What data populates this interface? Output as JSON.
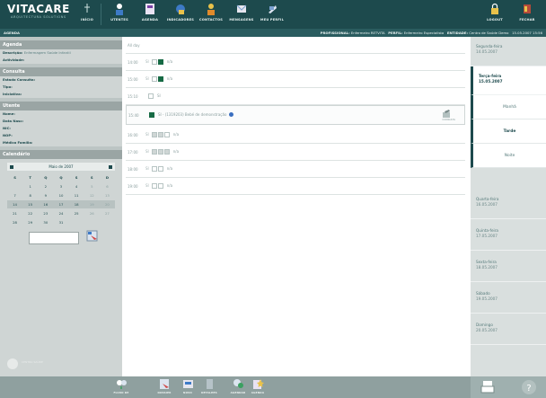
{
  "app": {
    "name": "VITACARE",
    "tagline": "ARQUITECTURA SOLUTIONS"
  },
  "topnav": [
    {
      "id": "inicio",
      "label": "INÍCIO",
      "icon": "home-icon"
    },
    {
      "id": "utentes",
      "label": "UTENTES",
      "icon": "user-icon"
    },
    {
      "id": "agenda",
      "label": "AGENDA",
      "icon": "agenda-icon"
    },
    {
      "id": "indicadores",
      "label": "INDICADORES",
      "icon": "indicators-icon"
    },
    {
      "id": "contactos",
      "label": "CONTACTOS",
      "icon": "contacts-icon"
    },
    {
      "id": "mensagens",
      "label": "MENSAGENS",
      "icon": "messages-icon"
    },
    {
      "id": "meu-perfil",
      "label": "MEU PERFIL",
      "icon": "profile-icon"
    }
  ],
  "topright": {
    "logout": "LOGOUT",
    "fechar": "FECHAR"
  },
  "infobar": {
    "section": "AGENDA",
    "profissional_label": "PROFISSIONAL:",
    "profissional_value": "Enfermeiro RETVITA",
    "perfil_label": "PERFIL:",
    "perfil_value": "Enfermeiro Especialista",
    "entidade_label": "ENTIDADE:",
    "entidade_value": "Centro de Saúde Demo",
    "datetime": "15.05.2007 15:56"
  },
  "sidebar": {
    "agenda": {
      "title": "Agenda",
      "descricao_label": "Descrição:",
      "descricao_value": "Enfermagem Saúde Infantil",
      "actividade_label": "Actividade:"
    },
    "consulta": {
      "title": "Consulta",
      "estado_label": "Estado Consulta:",
      "tipo_label": "Tipo:",
      "iniciativa_label": "Iniciativa:"
    },
    "utente": {
      "title": "Utente",
      "nome_label": "Nome:",
      "data_nasc_label": "Data Nasc:",
      "nic_label": "NIC:",
      "nop_label": "NOP:",
      "medico_label": "Médico Família:"
    },
    "calendario": {
      "title": "Calendário",
      "month": "Maio de 2007",
      "weekdays": [
        "S",
        "T",
        "Q",
        "Q",
        "S",
        "S",
        "D"
      ],
      "weeks": [
        [
          "",
          "1",
          "2",
          "3",
          "4",
          "5",
          "6"
        ],
        [
          "7",
          "8",
          "9",
          "10",
          "11",
          "12",
          "13"
        ],
        [
          "14",
          "15",
          "16",
          "17",
          "18",
          "19",
          "20"
        ],
        [
          "21",
          "22",
          "23",
          "24",
          "25",
          "26",
          "27"
        ],
        [
          "28",
          "29",
          "30",
          "31",
          "",
          "",
          ""
        ]
      ]
    },
    "bottom_logo": "CENTRO SAÚDE"
  },
  "schedule": {
    "all_day": "All day",
    "slots": [
      {
        "time": "14:00",
        "mark": "SI",
        "boxes": [
          "e",
          "f"
        ],
        "text": "n/a"
      },
      {
        "time": "15:00",
        "mark": "SI",
        "boxes": [
          "e",
          "f"
        ],
        "text": "n/a"
      },
      {
        "time": "15:10",
        "mark": "",
        "boxes": [
          "e"
        ],
        "text": "SI"
      },
      {
        "time": "15:40",
        "mark": "",
        "boxes": [
          "f"
        ],
        "text": "SI - (1319203) Bebé de demonstração"
      },
      {
        "time": "16:00",
        "mark": "SI",
        "boxes": [
          "g",
          "g",
          "e"
        ],
        "text": "n/a"
      },
      {
        "time": "17:00",
        "mark": "SI",
        "boxes": [
          "g",
          "g",
          "g"
        ],
        "text": "n/a"
      },
      {
        "time": "18:00",
        "mark": "SI",
        "boxes": [
          "e",
          "e"
        ],
        "text": "n/a"
      },
      {
        "time": "19:00",
        "mark": "SI",
        "boxes": [
          "e",
          "e"
        ],
        "text": "n/a"
      }
    ],
    "edit_label": "CONSULTA"
  },
  "days": [
    {
      "name": "Segunda-feira",
      "date": "14.05.2007"
    },
    {
      "name": "Terça-feira",
      "date": "15.05.2007"
    },
    {
      "name": "Quarta-feira",
      "date": "16.05.2007"
    },
    {
      "name": "Quinta-feira",
      "date": "17.05.2007"
    },
    {
      "name": "Sexta-feira",
      "date": "18.05.2007"
    },
    {
      "name": "Sábado",
      "date": "19.05.2007"
    },
    {
      "name": "Domingo",
      "date": "20.05.2007"
    }
  ],
  "periods": {
    "manha": "Manhã",
    "tarde": "Tarde",
    "noite": "Noite"
  },
  "bottombar": [
    {
      "id": "fluxo",
      "label": "FLUXO DE",
      "icon": "flow-icon"
    },
    {
      "id": "dossier",
      "label": "DOSSIER",
      "icon": "dossier-icon"
    },
    {
      "id": "novo",
      "label": "NOVO",
      "icon": "new-icon"
    },
    {
      "id": "detalhes",
      "label": "DETALHES",
      "icon": "details-icon"
    },
    {
      "id": "agendar",
      "label": "AGENDAR",
      "icon": "schedule-icon"
    },
    {
      "id": "agenda2",
      "label": "AGENDA",
      "icon": "agenda-star-icon"
    }
  ],
  "colors": {
    "header": "#1d4a4d",
    "accent": "#166a44",
    "sidebar": "#cfd5d4",
    "info": "#3a6fc0"
  }
}
